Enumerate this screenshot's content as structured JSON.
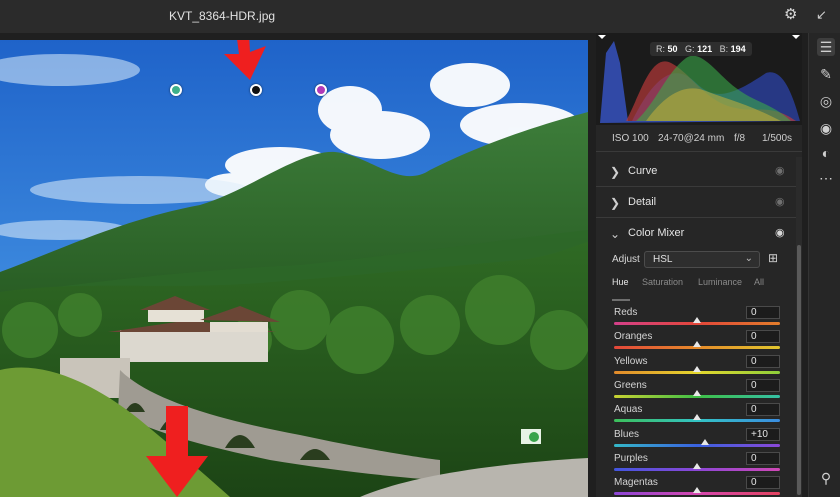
{
  "window": {
    "filename": "KVT_8364-HDR.jpg",
    "icons": [
      "gear-icon",
      "collapse-icon"
    ]
  },
  "photo": {
    "pins": [
      {
        "name": "color-sampler-green",
        "color": "#3db08a"
      },
      {
        "name": "color-sampler-selected",
        "color": "#111111"
      },
      {
        "name": "color-sampler-purple",
        "color": "#b03ab8"
      }
    ],
    "arrow_color": "#ef1f1f"
  },
  "histogram": {
    "readout": {
      "r_label": "R:",
      "r": "50",
      "g_label": "G:",
      "g": "121",
      "b_label": "B:",
      "b": "194"
    }
  },
  "exif": {
    "iso": "ISO 100",
    "lens": "24-70@24 mm",
    "aperture": "f/8",
    "shutter": "1/500s"
  },
  "sections": [
    {
      "title": "Curve",
      "expanded": false
    },
    {
      "title": "Detail",
      "expanded": false
    },
    {
      "title": "Color Mixer",
      "expanded": true
    }
  ],
  "color_mixer": {
    "adjust_label": "Adjust",
    "adjust_value": "HSL",
    "tabs": [
      "Hue",
      "Saturation",
      "Luminance",
      "All"
    ],
    "active_tab": "Hue",
    "rows": [
      {
        "label": "Reds",
        "value": "0",
        "level": 0.5,
        "gradient": [
          "#d4408a",
          "#e3473a",
          "#e37d2b"
        ]
      },
      {
        "label": "Oranges",
        "value": "0",
        "level": 0.5,
        "gradient": [
          "#e3473a",
          "#e58a2a",
          "#e2c72e"
        ]
      },
      {
        "label": "Yellows",
        "value": "0",
        "level": 0.5,
        "gradient": [
          "#e38a2b",
          "#e4d62e",
          "#8fd03a"
        ]
      },
      {
        "label": "Greens",
        "value": "0",
        "level": 0.5,
        "gradient": [
          "#c9d232",
          "#3fbf46",
          "#35c1a6"
        ]
      },
      {
        "label": "Aquas",
        "value": "0",
        "level": 0.5,
        "gradient": [
          "#3cbf5a",
          "#33c3c4",
          "#3b8de0"
        ]
      },
      {
        "label": "Blues",
        "value": "+10",
        "level": 0.55,
        "gradient": [
          "#34b8c8",
          "#3a62e0",
          "#8a48d8"
        ]
      },
      {
        "label": "Purples",
        "value": "0",
        "level": 0.5,
        "gradient": [
          "#4256df",
          "#8c47d6",
          "#d048b6"
        ]
      },
      {
        "label": "Magentas",
        "value": "0",
        "level": 0.5,
        "gradient": [
          "#8b46d6",
          "#d548b0",
          "#e24460"
        ]
      }
    ]
  },
  "tools": [
    "edit-sliders-icon",
    "brush-icon",
    "mask-icon",
    "redeye-icon",
    "presets-icon",
    "more-icon",
    "zoom-icon"
  ]
}
